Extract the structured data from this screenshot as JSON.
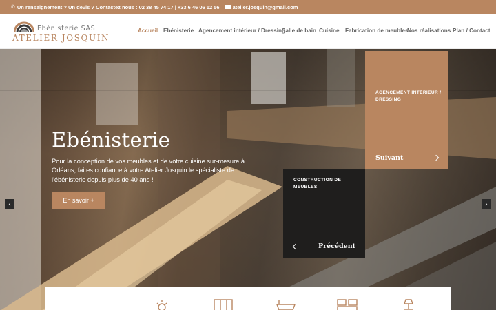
{
  "topbar": {
    "contact_text": "Un renseignement ? Un devis ? Contactez nous : 02 38 45 74 17 | +33 6 46 06 12 56",
    "email": "atelier.josquin@gmail.com"
  },
  "logo": {
    "line1": "Ebénisterie SAS",
    "line2": "ATELIER JOSQUIN"
  },
  "nav": {
    "items": [
      {
        "label": "Accueil",
        "active": true
      },
      {
        "label": "Ebénisterie"
      },
      {
        "label": "Agencement intérieur / Dressing"
      },
      {
        "label": "Salle de bain"
      },
      {
        "label": "Cuisine"
      },
      {
        "label": "Fabrication de meubles"
      },
      {
        "label": "Nos réalisations"
      },
      {
        "label": "Plan / Contact"
      }
    ]
  },
  "hero": {
    "title": "Ebénisterie",
    "text": "Pour la conception de vos meubles et de votre cuisine sur-mesure à Orléans, faites confiance à votre Atelier Josquin le spécialiste de l'ébénisterie depuis plus de 40 ans !",
    "button": "En savoir +"
  },
  "next_card": {
    "title": "Agencement intérieur / Dressing",
    "label": "Suivant"
  },
  "prev_card": {
    "title": "Construction de meubles",
    "label": "Précédent"
  },
  "slider": {
    "left_arrow": "‹",
    "right_arrow": "›"
  },
  "colors": {
    "accent": "#b98660",
    "dark_card": "#1f1e1d"
  }
}
